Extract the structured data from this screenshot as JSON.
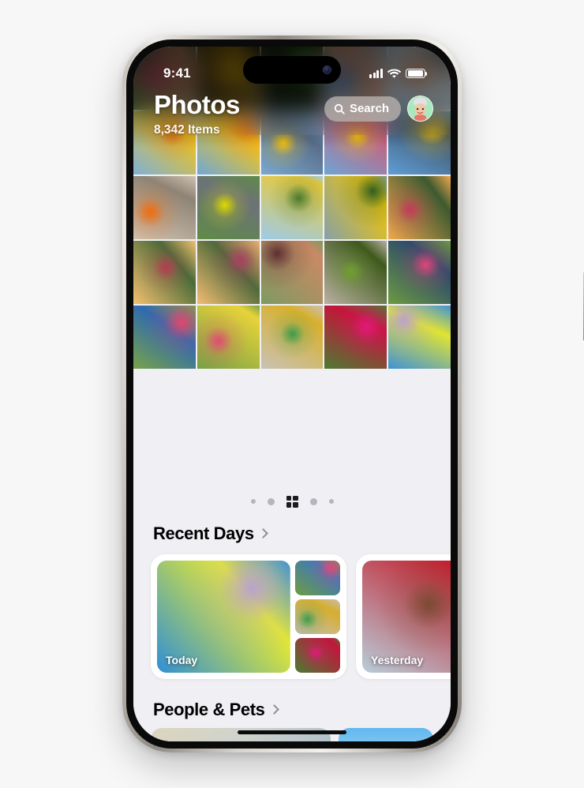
{
  "device": {
    "name": "iPhone",
    "status_bar": {
      "time": "9:41",
      "cellular_icon": "cellular-bars-icon",
      "wifi_icon": "wifi-icon",
      "battery_icon": "battery-full-icon"
    },
    "dynamic_island": "dynamic-island",
    "home_indicator": "home-indicator"
  },
  "app": {
    "title": "Photos",
    "item_count": "8,342 Items",
    "search": {
      "label": "Search",
      "icon": "search-icon"
    },
    "avatar": {
      "name": "profile-avatar",
      "background": "#a8e8bd"
    }
  },
  "pagination": {
    "indicators": [
      "dot-sm",
      "dot-md",
      "grid-active",
      "dot-md",
      "dot-sm"
    ],
    "active_index": 2,
    "active_color": "#1c1c1e",
    "inactive_color": "#b6b5bb"
  },
  "sections": [
    {
      "title": "Recent Days",
      "chevron": "chevron-right-icon"
    },
    {
      "title": "People & Pets",
      "chevron": "chevron-right-icon"
    }
  ],
  "recent_days": [
    {
      "label": "Today"
    },
    {
      "label": "Yesterday"
    }
  ],
  "colors": {
    "page_background": "#f7f7f7",
    "content_background": "#f0eff4",
    "card_background": "#ffffff",
    "text_primary": "#000000",
    "text_on_photo": "#ffffff"
  },
  "photo_grid": {
    "columns": 5,
    "rows": 5,
    "tiles": [
      {
        "id": "p1",
        "desc": "girl in pink kurta outdoors",
        "c1": "#3f6a36",
        "c2": "#d8246f",
        "c3": "#b5745a"
      },
      {
        "id": "p2",
        "desc": "sunflower close-up",
        "c1": "#1d1a10",
        "c2": "#f2b705",
        "c3": "#7a5e12"
      },
      {
        "id": "p3",
        "desc": "green plant in dark room",
        "c1": "#0e1a0c",
        "c2": "#4f8c33",
        "c3": "#17220f"
      },
      {
        "id": "p4",
        "desc": "smiling girl in blue striped top",
        "c1": "#9fb5c4",
        "c2": "#1763b8",
        "c3": "#c98f6e"
      },
      {
        "id": "p5",
        "desc": "child in orange sari under sky",
        "c1": "#9dc6e6",
        "c2": "#e8620c",
        "c3": "#dcdcd8"
      },
      {
        "id": "p6",
        "desc": "woman with marigold garland at shore",
        "c1": "#7fb0d8",
        "c2": "#e06a10",
        "c3": "#f0c419"
      },
      {
        "id": "p7",
        "desc": "back view orange skirt marigolds",
        "c1": "#6fa8d6",
        "c2": "#ef6b10",
        "c3": "#f5c518"
      },
      {
        "id": "p8",
        "desc": "man carrying marigold garlands",
        "c1": "#7aa9cd",
        "c2": "#f3c20d",
        "c3": "#5a6e8c"
      },
      {
        "id": "p9",
        "desc": "people framed by marigold garland",
        "c1": "#6ea5d4",
        "c2": "#f7c606",
        "c3": "#d8546e"
      },
      {
        "id": "p10",
        "desc": "two people with garlands blue sky",
        "c1": "#5f9ed6",
        "c2": "#f6c507",
        "c3": "#3f4f63"
      },
      {
        "id": "p11",
        "desc": "orange fabric on sand beach",
        "c1": "#cfc2b0",
        "c2": "#f06c0d",
        "c3": "#8e8476"
      },
      {
        "id": "p12",
        "desc": "child skateboarding on road",
        "c1": "#5f8b46",
        "c2": "#ddd900",
        "c3": "#6c7277"
      },
      {
        "id": "p13",
        "desc": "kids with balloons under tree",
        "c1": "#9ecbe8",
        "c2": "#4a7a2c",
        "c3": "#e8c93a"
      },
      {
        "id": "p14",
        "desc": "sunflower field",
        "c1": "#86a1a8",
        "c2": "#2f5f22",
        "c3": "#f0c40a"
      },
      {
        "id": "p15",
        "desc": "group celebrating at sunset",
        "c1": "#f0a84e",
        "c2": "#c53a5a",
        "c3": "#3e5a30"
      },
      {
        "id": "p16",
        "desc": "crowd dancing golden hour",
        "c1": "#f5c070",
        "c2": "#b83a52",
        "c3": "#4a6b38"
      },
      {
        "id": "p17",
        "desc": "two people high-five sunset",
        "c1": "#f3bd72",
        "c2": "#a94060",
        "c3": "#4e6a3a"
      },
      {
        "id": "p18",
        "desc": "girl smiling in maroon top",
        "c1": "#7e9a62",
        "c2": "#5e2f33",
        "c3": "#c98a64"
      },
      {
        "id": "p19",
        "desc": "pile of green gourds",
        "c1": "#b9b0a2",
        "c2": "#6fa02c",
        "c3": "#3f5a1c"
      },
      {
        "id": "p20",
        "desc": "children playing on grass",
        "c1": "#6d9a40",
        "c2": "#e0457a",
        "c3": "#2d4a6b"
      },
      {
        "id": "p21",
        "desc": "kids with colorful bags on lawn",
        "c1": "#79a347",
        "c2": "#e2456f",
        "c3": "#2f6ab0"
      },
      {
        "id": "p22",
        "desc": "children sharing bright bags",
        "c1": "#76a145",
        "c2": "#e04a72",
        "c3": "#e8d23a"
      },
      {
        "id": "p23",
        "desc": "girl in green dress by wall",
        "c1": "#c9c2b6",
        "c2": "#3d9b4a",
        "c3": "#d8b02c"
      },
      {
        "id": "p24",
        "desc": "girl in red among pink flowers",
        "c1": "#4e7a33",
        "c2": "#e2197a",
        "c3": "#c4153a"
      },
      {
        "id": "p25",
        "desc": "three girls seated against sky",
        "c1": "#3f92d8",
        "c2": "#b9a0cf",
        "c3": "#e0e432"
      }
    ]
  },
  "card_images": {
    "today_hero": {
      "desc": "three girls seated on sand mound",
      "c1": "#2f8fd6",
      "c2": "#b9a2cf",
      "c3": "#e2e833"
    },
    "today_thumb_1": {
      "desc": "kids playing on grass",
      "c1": "#6f9c42",
      "c2": "#e2467a",
      "c3": "#3d7ab8"
    },
    "today_thumb_2": {
      "desc": "girl in green dress by wall",
      "c1": "#c6bfb2",
      "c2": "#3f9d4c",
      "c3": "#d6ae2e"
    },
    "today_thumb_3": {
      "desc": "pink bougainvillea flowers",
      "c1": "#4d7a32",
      "c2": "#e01a7c",
      "c3": "#c2163c"
    },
    "yesterday_hero": {
      "desc": "portrait of smiling girl",
      "c1": "#b8cdd8",
      "c2": "#7a4a33",
      "c3": "#c41f2e"
    }
  }
}
